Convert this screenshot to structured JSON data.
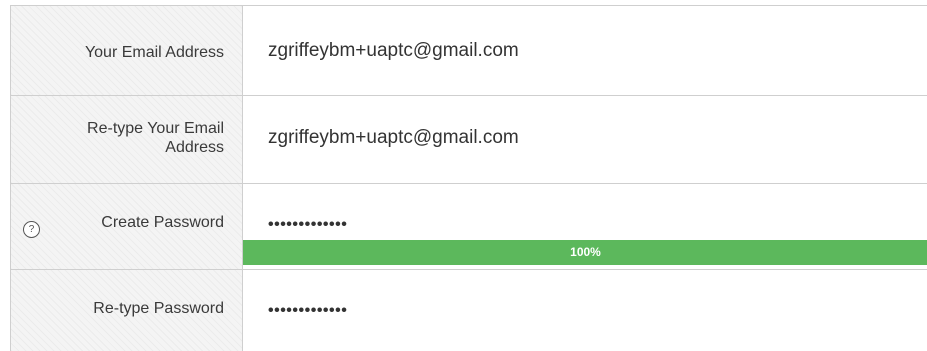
{
  "form": {
    "email_label": "Your Email Address",
    "email_value": "zgriffeybm+uaptc@gmail.com",
    "retype_email_label_line1": "Re-type Your Email",
    "retype_email_label_line2": "Address",
    "retype_email_value": "zgriffeybm+uaptc@gmail.com",
    "create_password_label": "Create Password",
    "create_password_value": "•••••••••••••",
    "help_icon_glyph": "?",
    "strength_percent": 100,
    "strength_text": "100%",
    "strength_color": "#5cb85c",
    "retype_password_label": "Re-type Password",
    "retype_password_value": "•••••••••••••"
  }
}
